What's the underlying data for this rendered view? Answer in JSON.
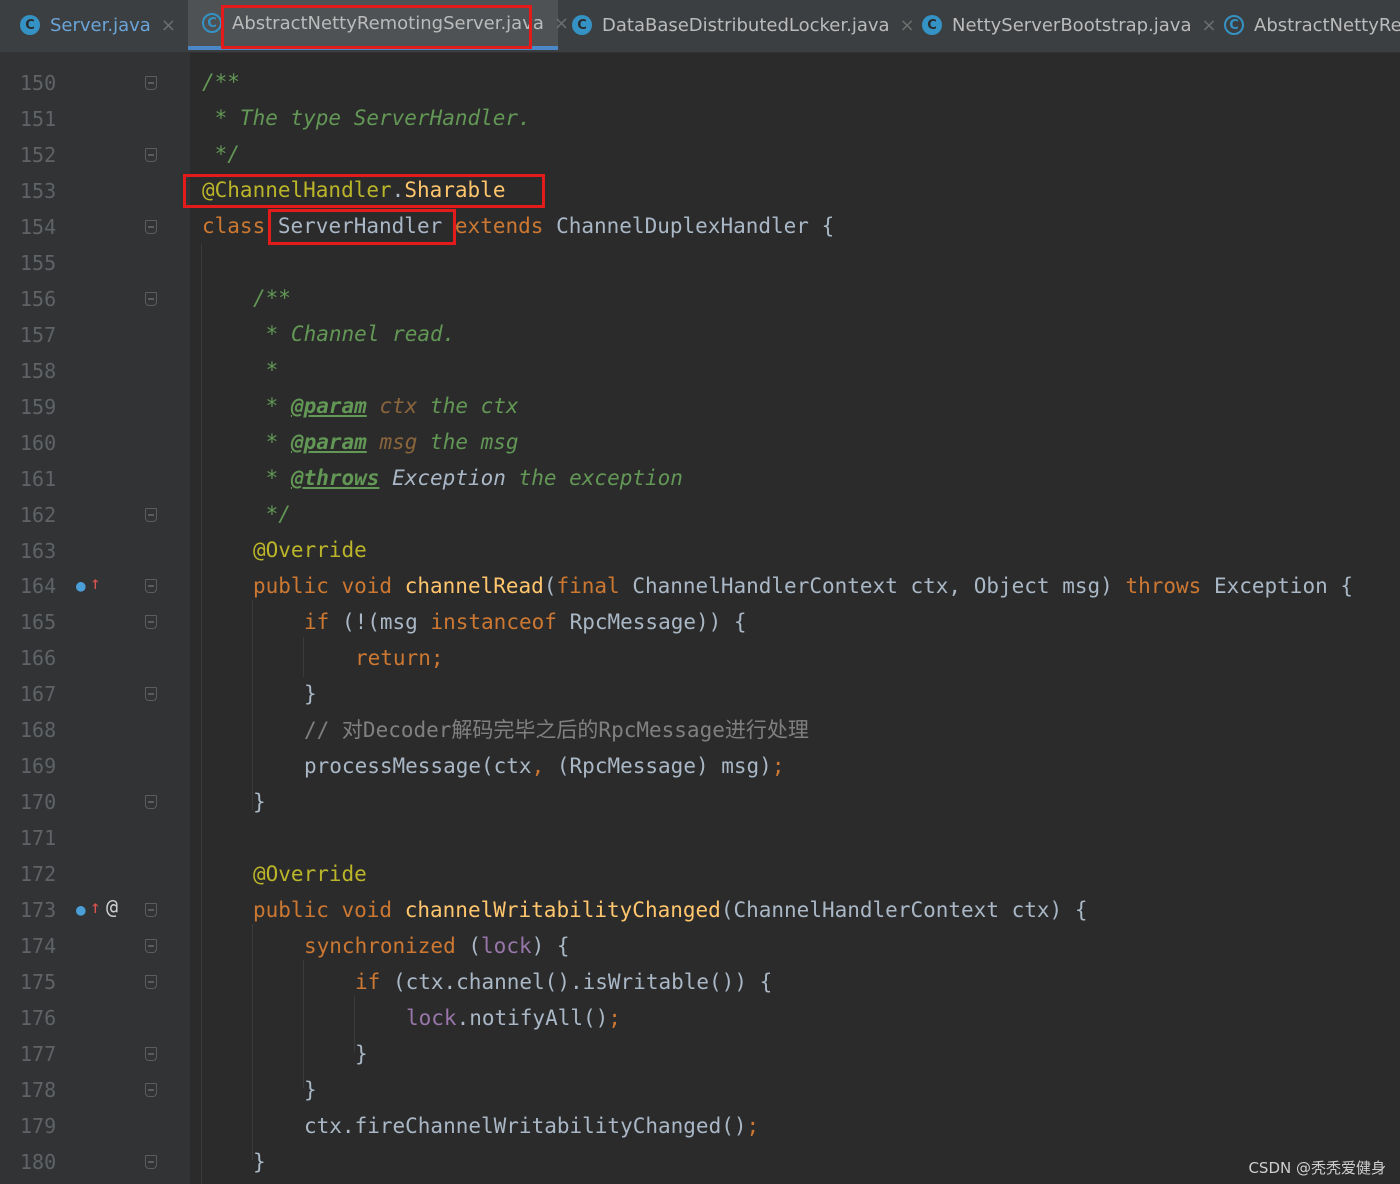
{
  "tabs": [
    {
      "label": "Server.java",
      "icon": "c-class-icon",
      "active": false
    },
    {
      "label": "AbstractNettyRemotingServer.java",
      "icon": "c-abstract-class-icon",
      "active": true
    },
    {
      "label": "DataBaseDistributedLocker.java",
      "icon": "c-class-icon",
      "active": false
    },
    {
      "label": "NettyServerBootstrap.java",
      "icon": "c-class-icon",
      "active": false
    },
    {
      "label": "AbstractNettyRer",
      "icon": "c-abstract-class-icon",
      "active": false
    }
  ],
  "line_numbers": [
    "150",
    "151",
    "152",
    "153",
    "154",
    "155",
    "156",
    "157",
    "158",
    "159",
    "160",
    "161",
    "162",
    "163",
    "164",
    "165",
    "166",
    "167",
    "168",
    "169",
    "170",
    "171",
    "172",
    "173",
    "174",
    "175",
    "176",
    "177",
    "178",
    "179",
    "180"
  ],
  "code": {
    "l150": "/**",
    "l151": " * The type ServerHandler.",
    "l152": " */",
    "l153_ann": "@ChannelHandler",
    "l153_dot": ".",
    "l153_name": "Sharable",
    "l154_class": "class",
    "l154_name": "ServerHandler",
    "l154_extends": "extends",
    "l154_rest": "ChannelDuplexHandler {",
    "l156": "/**",
    "l157": " * Channel read.",
    "l158": " *",
    "l159_star": " * ",
    "l159_tag": "@param",
    "l159_name": "ctx",
    "l159_desc": "the ctx",
    "l160_star": " * ",
    "l160_tag": "@param",
    "l160_name": "msg",
    "l160_desc": "the msg",
    "l161_star": " * ",
    "l161_tag": "@throws",
    "l161_type": "Exception",
    "l161_desc": "the exception",
    "l162": " */",
    "l163": "@Override",
    "l164_mods": "public void",
    "l164_fn": "channelRead",
    "l164_paren": "(",
    "l164_final": "final",
    "l164_params": "ChannelHandlerContext ctx, Object msg)",
    "l164_throws": "throws",
    "l164_rest": "Exception {",
    "l165_if": "if",
    "l165_a": "(!(msg",
    "l165_inst": "instanceof",
    "l165_b": "RpcMessage)) {",
    "l166": "return;",
    "l167": "}",
    "l168": "// 对Decoder解码完毕之后的RpcMessage进行处理",
    "l169_a": "processMessage(ctx",
    "l169_comma": ",",
    "l169_b": "(RpcMessage) msg)",
    "l169_semi": ";",
    "l170": "}",
    "l172": "@Override",
    "l173_mods": "public void",
    "l173_fn": "channelWritabilityChanged",
    "l173_rest": "(ChannelHandlerContext ctx) {",
    "l174_sync": "synchronized",
    "l174_a": "(",
    "l174_lock": "lock",
    "l174_b": ") {",
    "l175_if": "if",
    "l175_rest": "(ctx.channel().isWritable()) {",
    "l176_lock": "lock",
    "l176_rest": ".notifyAll()",
    "l176_semi": ";",
    "l177": "}",
    "l178": "}",
    "l179_a": "ctx.fireChannelWritabilityChanged()",
    "l179_semi": ";",
    "l180": "}"
  },
  "watermark": "CSDN @秃秃爱健身",
  "colors": {
    "background": "#2b2b2b",
    "keyword": "#cc7832",
    "doc_comment": "#629755",
    "annotation": "#bbb529",
    "method": "#ffc66d",
    "field": "#9876aa",
    "highlight_box": "#e41b1b"
  }
}
